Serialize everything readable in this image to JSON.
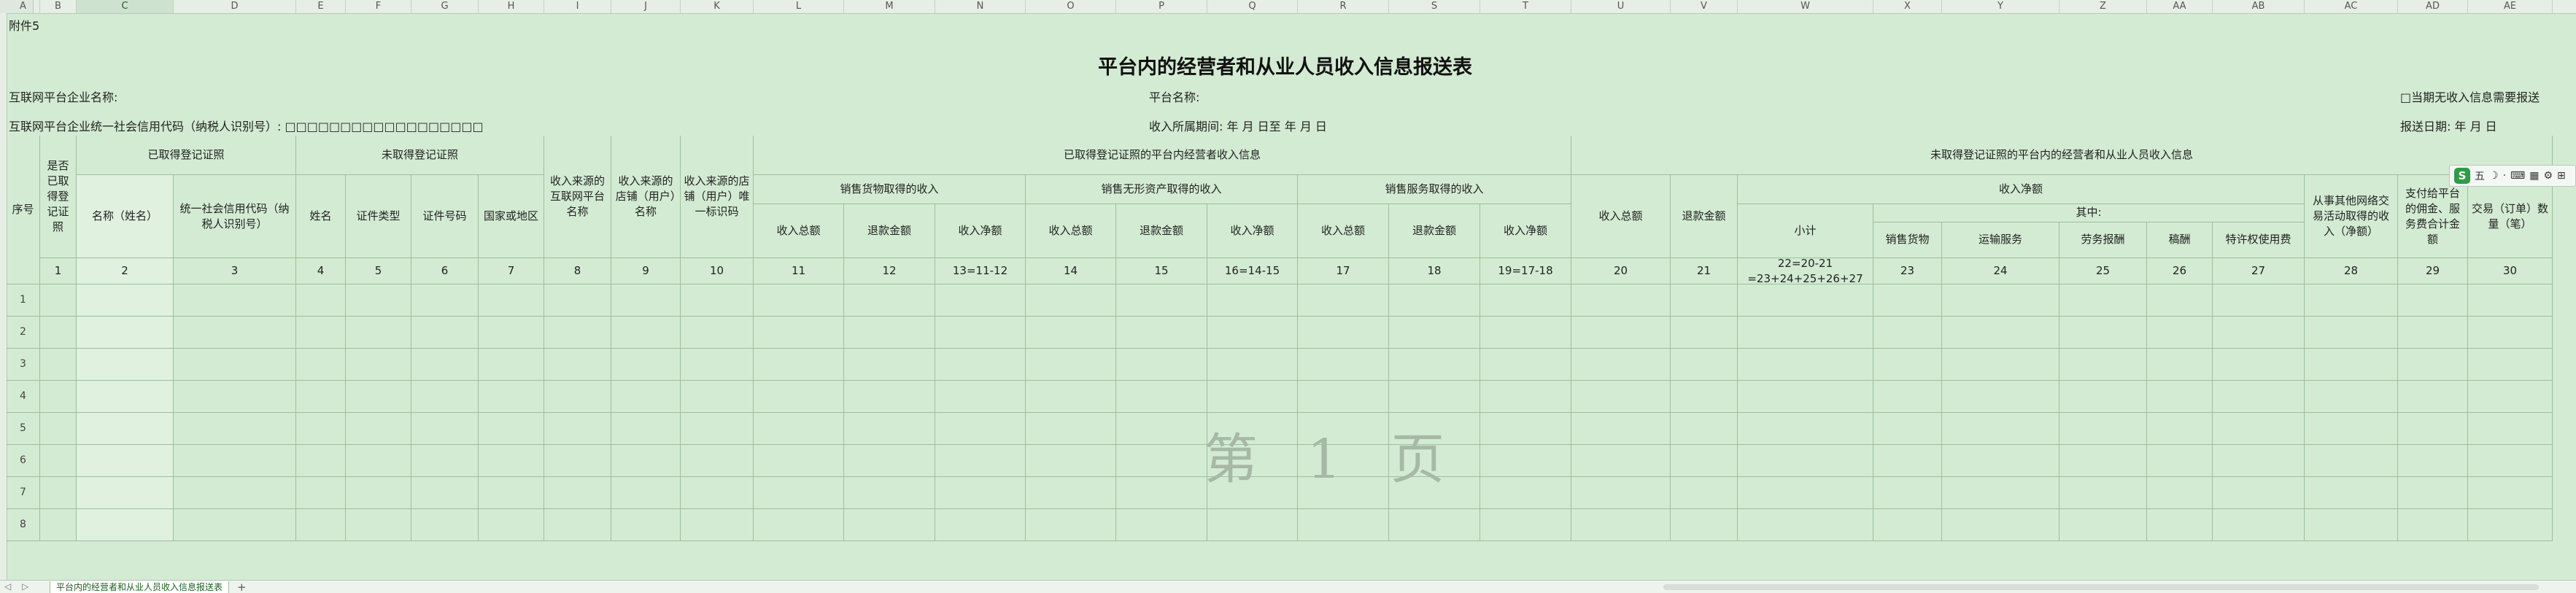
{
  "columns": [
    "A",
    "B",
    "C",
    "D",
    "E",
    "F",
    "G",
    "H",
    "I",
    "J",
    "K",
    "L",
    "M",
    "N",
    "O",
    "P",
    "Q",
    "R",
    "S",
    "T",
    "U",
    "V",
    "W",
    "X",
    "Y",
    "Z",
    "AA",
    "AB",
    "AC",
    "AD",
    "AE"
  ],
  "sheet": {
    "attachment": "附件5",
    "title": "平台内的经营者和从业人员收入信息报送表",
    "company_name_label": "互联网平台企业名称:",
    "platform_name_label": "平台名称:",
    "no_income_label": "□当期无收入信息需要报送",
    "credit_code_label": "互联网平台企业统一社会信用代码（纳税人识别号）: □□□□□□□□□□□□□□□□□□",
    "period_label": "收入所属期间:     年   月   日至     年   月   日",
    "report_date_label": "报送日期:     年   月   日"
  },
  "headers": {
    "seq": "序号",
    "registered": "是否已取得登记证照",
    "obtained_license": "已取得登记证照",
    "not_obtained_license": "未取得登记证照",
    "name_title": "名称（姓名）",
    "credit_code": "统一社会信用代码（纳税人识别号）",
    "name": "姓名",
    "id_type": "证件类型",
    "id_no": "证件号码",
    "country": "国家或地区",
    "platform": "收入来源的互联网平台名称",
    "store_name": "收入来源的店铺（用户）名称",
    "store_id": "收入来源的店铺（用户）唯一标识码",
    "reg_income": "已取得登记证照的平台内经营者收入信息",
    "unreg_income": "未取得登记证照的平台内的经营者和从业人员收入信息",
    "goods_sales": "销售货物取得的收入",
    "intangible_sales": "销售无形资产取得的收入",
    "service_sales": "销售服务取得的收入",
    "total_income": "收入总额",
    "refund": "退款金额",
    "net_income": "收入净额",
    "subtotal": "小计",
    "among": "其中:",
    "goods": "销售货物",
    "transport": "运输服务",
    "labor": "劳务报酬",
    "royalty": "稿酬",
    "license_fee": "特许权使用费",
    "other_net": "从事其他网络交易活动取得的收入（净额）",
    "commission": "支付给平台的佣金、服务费合计金额",
    "order_qty": "交易（订单）数量（笔）"
  },
  "index_row": [
    "1",
    "2",
    "3",
    "4",
    "5",
    "6",
    "7",
    "8",
    "9",
    "10",
    "11",
    "12",
    "13=11-12",
    "14",
    "15",
    "16=14-15",
    "17",
    "18",
    "19=17-18",
    "20",
    "21",
    "22=20-21 =23+24+25+26+27",
    "23",
    "24",
    "25",
    "26",
    "27",
    "28",
    "29",
    "30"
  ],
  "data_rows": [
    "1",
    "2",
    "3",
    "4",
    "5",
    "6",
    "7",
    "8"
  ],
  "watermark": "第 1 页",
  "floating_toolbar": [
    "五",
    "☽",
    "·",
    "⌨",
    "▦",
    "⚙",
    "⊞"
  ],
  "floating_toolbar_logo": "S",
  "tabs": {
    "active": "平台内的经营者和从业人员收入信息报送表",
    "add": "+",
    "nav_first": "◁",
    "nav_last": "▷"
  }
}
